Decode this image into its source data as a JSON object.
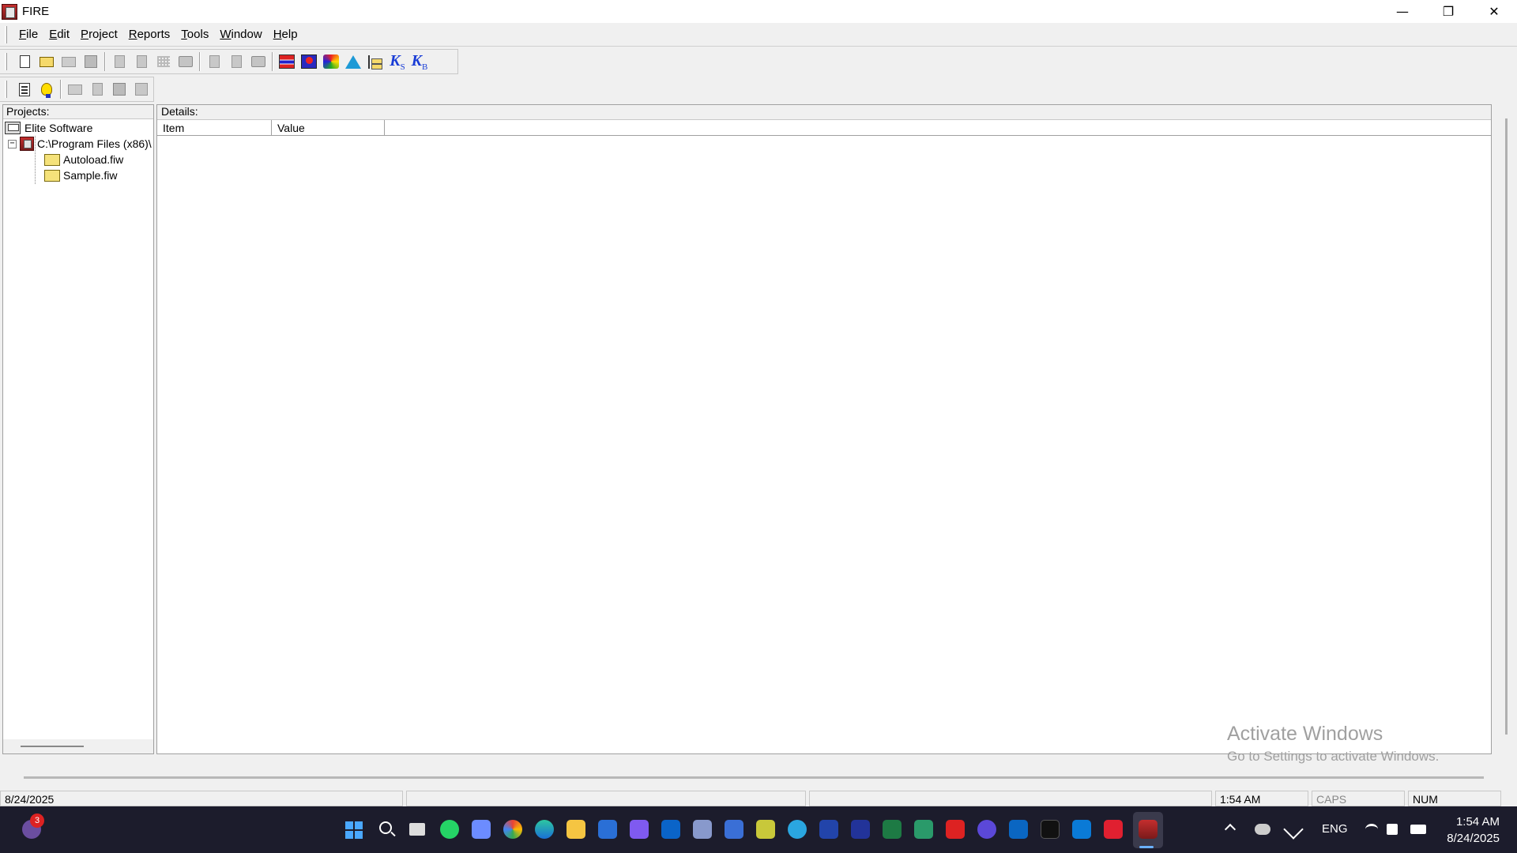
{
  "window": {
    "title": "FIRE",
    "minimize": "—",
    "maximize": "❐",
    "close": "✕"
  },
  "menu": [
    {
      "key": "F",
      "rest": "ile"
    },
    {
      "key": "E",
      "rest": "dit"
    },
    {
      "key": "P",
      "rest": "roject"
    },
    {
      "key": "R",
      "rest": "eports"
    },
    {
      "key": "T",
      "rest": "ools"
    },
    {
      "key": "W",
      "rest": "indow"
    },
    {
      "key": "H",
      "rest": "elp"
    }
  ],
  "toolbar": {
    "ks_letter": "K",
    "ks_sub": "S",
    "kb_letter": "K",
    "kb_sub": "B"
  },
  "projects": {
    "label": "Projects:",
    "root": "Elite Software",
    "folder": "C:\\Program Files (x86)\\",
    "expander": "−",
    "files": [
      "Autoload.fiw",
      "Sample.fiw"
    ]
  },
  "details": {
    "label": "Details:",
    "columns": [
      "Item",
      "Value"
    ]
  },
  "watermark": {
    "title": "Activate Windows",
    "subtitle": "Go to Settings to activate Windows."
  },
  "status": {
    "date": "8/24/2025",
    "time": "1:54 AM",
    "caps": "CAPS",
    "num": "NUM"
  },
  "taskbar": {
    "notification_count": "3",
    "language": "ENG",
    "clock_time": "1:54 AM",
    "clock_date": "8/24/2025"
  }
}
